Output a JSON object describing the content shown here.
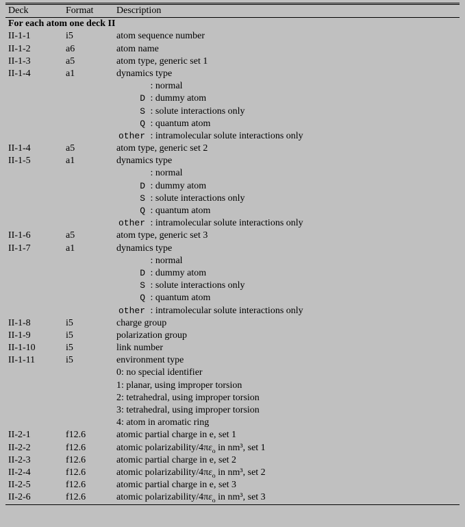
{
  "headers": {
    "deck": "Deck",
    "format": "Format",
    "description": "Description"
  },
  "section_title": "For each atom one deck II",
  "dyn_type_label": "dynamics type",
  "dyn_opts": [
    {
      "code": " ",
      "text": ": normal"
    },
    {
      "code": "D",
      "text": ": dummy atom"
    },
    {
      "code": "S",
      "text": ": solute interactions only"
    },
    {
      "code": "Q",
      "text": ": quantum atom"
    },
    {
      "code": "other",
      "text": ": intramolecular solute interactions only"
    }
  ],
  "env_type_label": "environment type",
  "env_opts": [
    {
      "code": "0",
      "text": "no special identifier"
    },
    {
      "code": "1",
      "text": "planar, using improper torsion"
    },
    {
      "code": "2",
      "text": "tetrahedral, using improper torsion"
    },
    {
      "code": "3",
      "text": "tetrahedral, using improper torsion"
    },
    {
      "code": "4",
      "text": "atom in aromatic ring"
    }
  ],
  "rows": {
    "r1": {
      "deck": "II-1-1",
      "format": "i5",
      "desc": "atom sequence number"
    },
    "r2": {
      "deck": "II-1-2",
      "format": "a6",
      "desc": "atom name"
    },
    "r3": {
      "deck": "II-1-3",
      "format": "a5",
      "desc": "atom type, generic set 1"
    },
    "r4": {
      "deck": "II-1-4",
      "format": "a1"
    },
    "r5": {
      "deck": "II-1-4",
      "format": "a5",
      "desc": "atom type, generic set 2"
    },
    "r6": {
      "deck": "II-1-5",
      "format": "a1"
    },
    "r7": {
      "deck": "II-1-6",
      "format": "a5",
      "desc": "atom type, generic set 3"
    },
    "r8": {
      "deck": "II-1-7",
      "format": "a1"
    },
    "r9": {
      "deck": "II-1-8",
      "format": "i5",
      "desc": "charge group"
    },
    "r10": {
      "deck": "II-1-9",
      "format": "i5",
      "desc": "polarization group"
    },
    "r11": {
      "deck": "II-1-10",
      "format": "i5",
      "desc": "link number"
    },
    "r12": {
      "deck": "II-1-11",
      "format": "i5"
    },
    "r13": {
      "deck": "II-2-1",
      "format": "f12.6",
      "desc_pre": "atomic partial charge in e, set 1"
    },
    "r14": {
      "deck": "II-2-2",
      "format": "f12.6",
      "desc_pre": "atomic polarizability/4π",
      "desc_post": " in nm³, set 1"
    },
    "r15": {
      "deck": "II-2-3",
      "format": "f12.6",
      "desc_pre": "atomic partial charge in e, set 2"
    },
    "r16": {
      "deck": "II-2-4",
      "format": "f12.6",
      "desc_pre": "atomic polarizability/4π",
      "desc_post": " in nm³, set 2"
    },
    "r17": {
      "deck": "II-2-5",
      "format": "f12.6",
      "desc_pre": "atomic partial charge in e, set 3"
    },
    "r18": {
      "deck": "II-2-6",
      "format": "f12.6",
      "desc_pre": "atomic polarizability/4π",
      "desc_post": " in nm³, set 3"
    }
  },
  "epsilon": "ε",
  "epsilon_sub": "o"
}
